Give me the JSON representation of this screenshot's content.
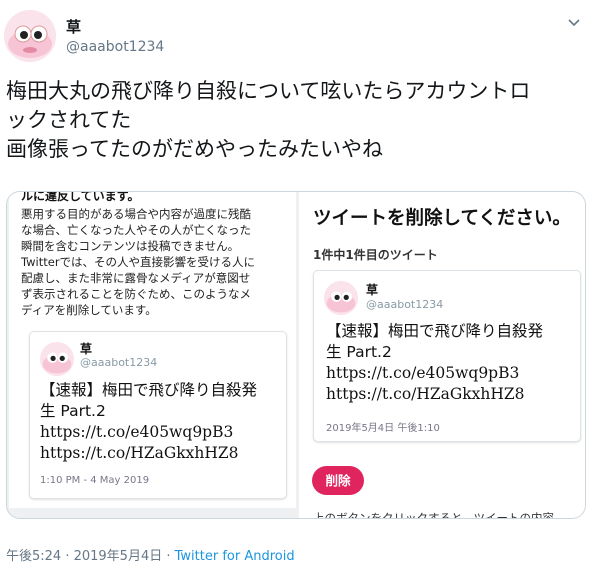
{
  "author": {
    "name": "草",
    "handle": "@aaabot1234"
  },
  "tweet": {
    "lines": [
      "梅田大丸の飛び降り自殺について呟いたらアカウントロ",
      "ックされてた",
      "画像張ってたのがだめやったみたいやね"
    ]
  },
  "media": {
    "left": {
      "warning_head": "ルに違反しています。",
      "warning_lines": [
        "悪用する目的がある場合や内容が過度に残酷",
        "な場合、亡くなった人やその人が亡くなった",
        "瞬間を含むコンテンツは投稿できません。",
        "Twitterでは、その人や直接影響を受ける人に",
        "配慮し、また非常に露骨なメディアが意図せ",
        "ず表示されることを防ぐため、このようなメ",
        "ディアを削除しています。"
      ],
      "card": {
        "name": "草",
        "handle": "@aaabot1234",
        "lines": [
          "【速報】梅田で飛び降り自殺発",
          "生 Part.2"
        ],
        "links": [
          "https://t.co/e405wq9pB3",
          "https://t.co/HZaGkxhHZ8"
        ],
        "date": "1:10 PM - 4 May 2019"
      }
    },
    "right": {
      "title": "ツイートを削除してください。",
      "subtitle": "1件中1件目のツイート",
      "card": {
        "name": "草",
        "handle": "@aaabot1234",
        "lines": [
          "【速報】梅田で飛び降り自殺発",
          "生 Part.2"
        ],
        "links": [
          "https://t.co/e405wq9pB3",
          "https://t.co/HZaGkxhHZ8"
        ],
        "date": "2019年5月4日 午後1:10"
      },
      "delete_label": "削除",
      "cut_text": "上のボタンをクリックすると、ツイートの内容"
    }
  },
  "footer": {
    "time": "午後5:24 · 2019年5月4日 · ",
    "source": "Twitter for Android"
  },
  "colors": {
    "accent": "#1b95e0",
    "delete": "#e0245e",
    "muted": "#657786"
  }
}
